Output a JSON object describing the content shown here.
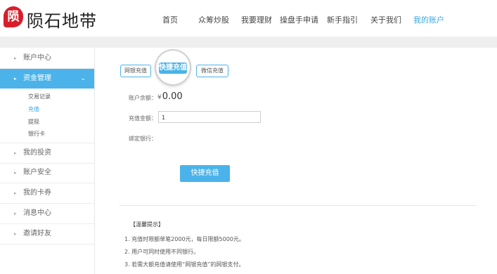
{
  "brand": {
    "logo_char": "陨",
    "name": "陨石地带"
  },
  "nav": [
    {
      "label": "首页",
      "active": false
    },
    {
      "label": "众筹炒股",
      "active": false
    },
    {
      "label": "我要理财",
      "active": false
    },
    {
      "label": "操盘手申请",
      "active": false
    },
    {
      "label": "新手指引",
      "active": false
    },
    {
      "label": "关于我们",
      "active": false
    },
    {
      "label": "我的账户",
      "active": true
    }
  ],
  "sidebar": {
    "items": [
      {
        "label": "账户中心"
      },
      {
        "label": "资金管理",
        "active": true
      },
      {
        "label": "我的投资"
      },
      {
        "label": "账户安全"
      },
      {
        "label": "我的卡券"
      },
      {
        "label": "消息中心"
      },
      {
        "label": "邀请好友"
      }
    ],
    "sub_items": [
      {
        "label": "交易记录"
      },
      {
        "label": "充值",
        "active": true
      },
      {
        "label": "提现"
      },
      {
        "label": "银行卡"
      }
    ]
  },
  "tabs": [
    {
      "label": "网银充值"
    },
    {
      "label": "快捷充值",
      "active": true
    },
    {
      "label": "微信充值"
    }
  ],
  "form": {
    "balance_label": "账户余额：",
    "currency": "¥",
    "balance_value": "0.00",
    "amount_label": "充值金额：",
    "amount_value": "1",
    "bank_label": "绑定银行：",
    "submit_label": "快捷充值"
  },
  "tips": {
    "title": "【温馨提示】",
    "items": [
      "1.  充值时限额单笔2000元，每日限额5000元。",
      "2.  用户可同时使用不同银行。",
      "3.  若需大额充值请使用“网银充值”的网银支付。"
    ]
  },
  "colors": {
    "accent": "#4bb3ea",
    "logo_red": "#d81e2a"
  }
}
